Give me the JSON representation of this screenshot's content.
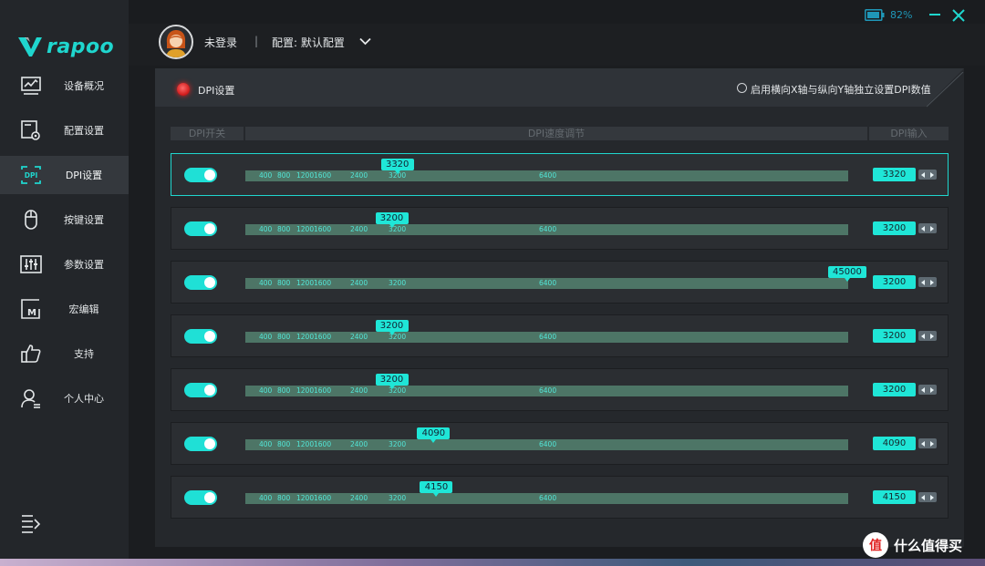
{
  "brand": {
    "name": "rapoo",
    "accent": "#1fd6ce"
  },
  "window": {
    "battery": "82%"
  },
  "header": {
    "login": "未登录",
    "separator": "|",
    "profile": "配置: 默认配置"
  },
  "sidebar": {
    "items": [
      {
        "label": "设备概况",
        "icon": "monitor-chart-icon"
      },
      {
        "label": "配置设置",
        "icon": "config-gear-icon"
      },
      {
        "label": "DPI设置",
        "icon": "dpi-icon",
        "active": true
      },
      {
        "label": "按键设置",
        "icon": "mouse-icon"
      },
      {
        "label": "参数设置",
        "icon": "sliders-icon"
      },
      {
        "label": "宏编辑",
        "icon": "macro-icon"
      },
      {
        "label": "支持",
        "icon": "thumbs-up-icon"
      },
      {
        "label": "个人中心",
        "icon": "user-icon"
      }
    ]
  },
  "dpi": {
    "title": "DPI设置",
    "xy_option": "启用横向X轴与纵向Y轴独立设置DPI数值",
    "columns": {
      "switch": "DPI开关",
      "slider": "DPI速度调节",
      "input": "DPI输入"
    },
    "ticks": [
      "400",
      "800",
      "1200",
      "1600",
      "2400",
      "3200",
      "6400"
    ],
    "slider_max": 45000,
    "rows": [
      {
        "enabled": true,
        "slider": 3320,
        "bubble": "3320",
        "input": "3320",
        "selected": true
      },
      {
        "enabled": true,
        "slider": 3200,
        "bubble": "3200",
        "input": "3200"
      },
      {
        "enabled": true,
        "slider": 45000,
        "bubble": "45000",
        "input": "3200"
      },
      {
        "enabled": true,
        "slider": 3200,
        "bubble": "3200",
        "input": "3200"
      },
      {
        "enabled": true,
        "slider": 3200,
        "bubble": "3200",
        "input": "3200"
      },
      {
        "enabled": true,
        "slider": 4090,
        "bubble": "4090",
        "input": "4090"
      },
      {
        "enabled": true,
        "slider": 4150,
        "bubble": "4150",
        "input": "4150"
      }
    ]
  },
  "watermark": {
    "badge": "值",
    "text": "什么值得买"
  }
}
